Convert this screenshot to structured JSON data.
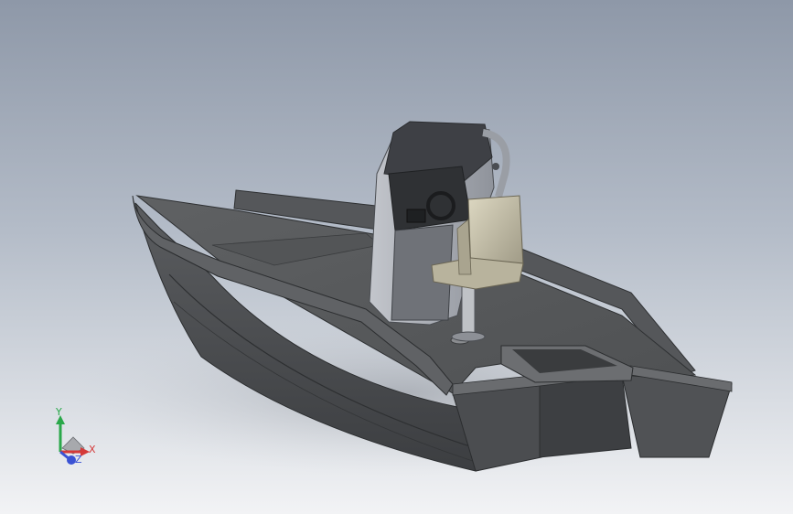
{
  "viewport": {
    "background_top": "#8e98a8",
    "background_bottom": "#f2f3f5"
  },
  "model": {
    "subject": "center-console-boat",
    "hull_color": "#4d4f51",
    "deck_color": "#5a5c5e",
    "console_color": "#a9acb3",
    "seat_color": "#c9c3a8"
  },
  "triad": {
    "y_label": "Y",
    "x_label": "X",
    "z_label": "Z",
    "y_color": "#2aa84a",
    "x_color": "#d43a3a",
    "z_color": "#3a52d4"
  }
}
